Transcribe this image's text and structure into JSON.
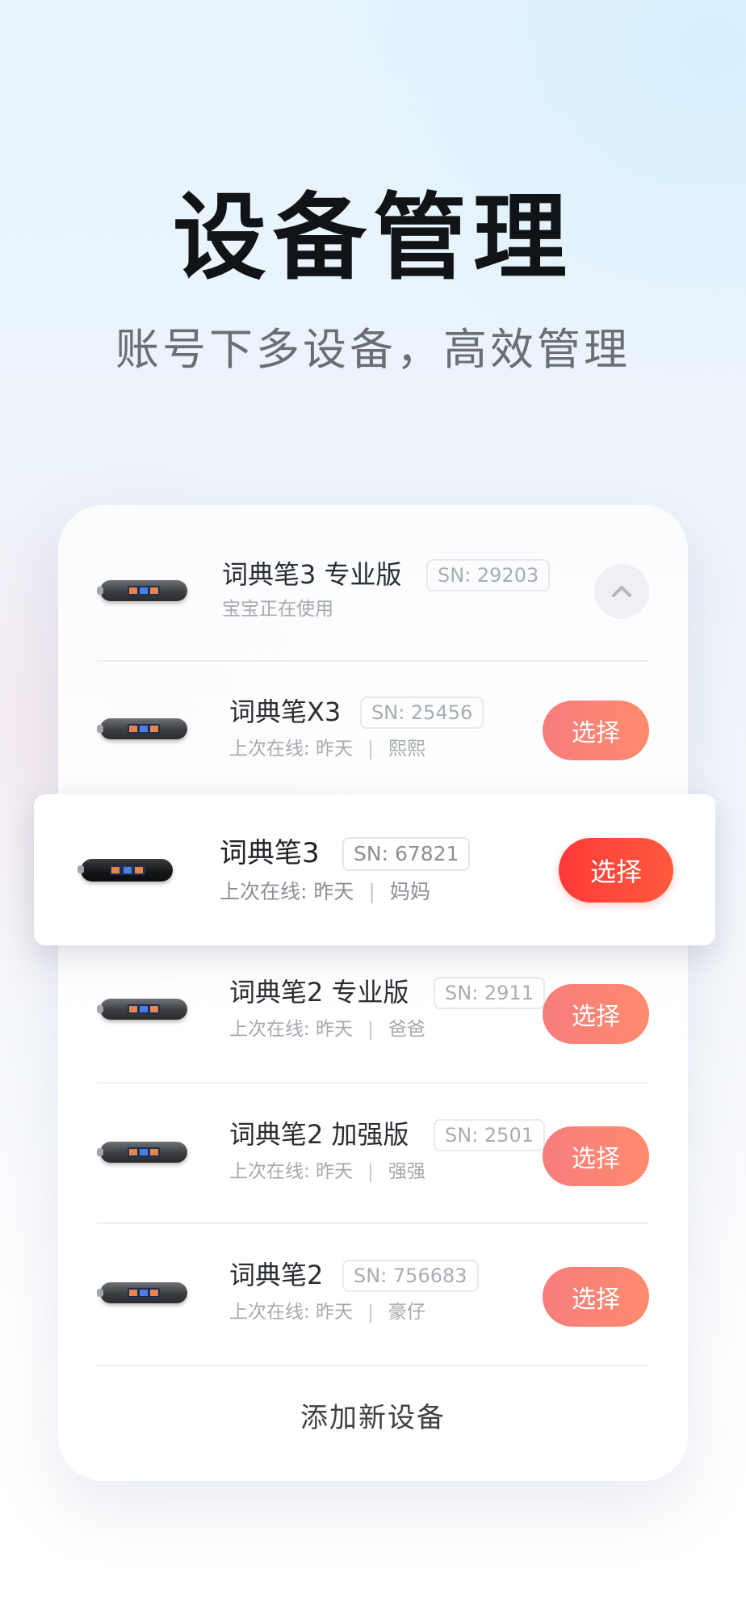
{
  "hero": {
    "title": "设备管理",
    "subtitle": "账号下多设备，高效管理"
  },
  "current_device": {
    "name": "词典笔3 专业版",
    "sn": "SN: 29203",
    "status": "宝宝正在使用",
    "icon": "chevron-up-icon"
  },
  "devices": [
    {
      "name": "词典笔X3",
      "sn": "SN: 25456",
      "last_online": "上次在线: 昨天",
      "separator": "|",
      "user": "熙熙",
      "button": "选择"
    },
    {
      "name": "词典笔3",
      "sn": "SN: 67821",
      "last_online": "上次在线: 昨天",
      "separator": "|",
      "user": "妈妈",
      "button": "选择"
    },
    {
      "name": "词典笔2 专业版",
      "sn": "SN: 2911",
      "last_online": "上次在线: 昨天",
      "separator": "|",
      "user": "爸爸",
      "button": "选择"
    },
    {
      "name": "词典笔2 加强版",
      "sn": "SN: 2501",
      "last_online": "上次在线: 昨天",
      "separator": "|",
      "user": "强强",
      "button": "选择"
    },
    {
      "name": "词典笔2",
      "sn": "SN: 756683",
      "last_online": "上次在线: 昨天",
      "separator": "|",
      "user": "豪仔",
      "button": "选择"
    }
  ],
  "footer": {
    "add_device": "添加新设备"
  },
  "colors": {
    "select_button": "#f87d7d",
    "select_button_active": "#ff3a3a",
    "title_text": "#111417",
    "subtitle_text": "#6b6e73"
  }
}
